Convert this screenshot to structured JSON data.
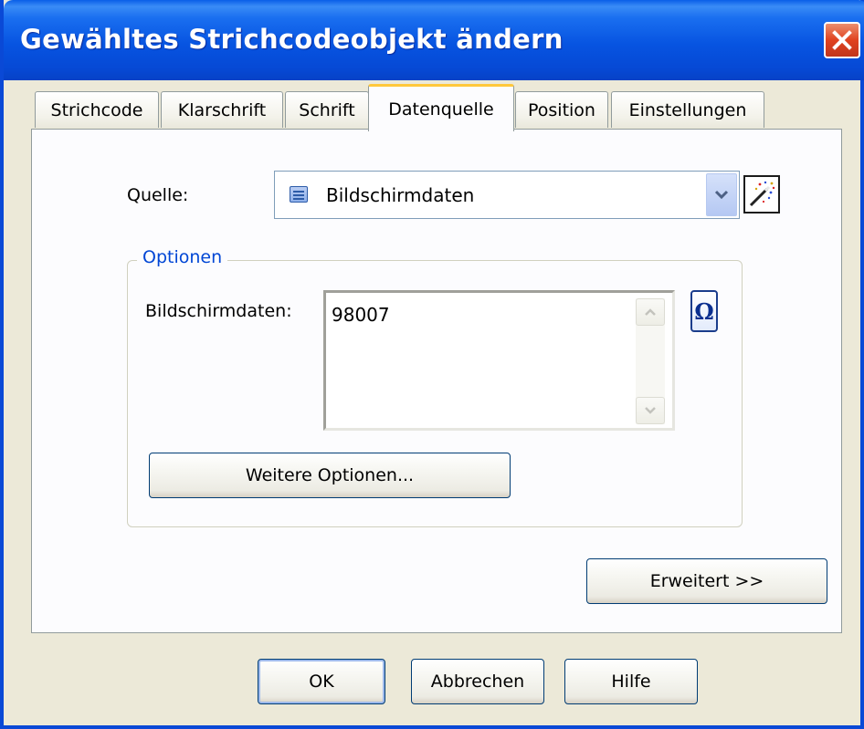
{
  "window": {
    "title": "Gewähltes Strichcodeobjekt ändern"
  },
  "tabs": [
    {
      "label": "Strichcode"
    },
    {
      "label": "Klarschrift"
    },
    {
      "label": "Schrift"
    },
    {
      "label": "Datenquelle",
      "active": true
    },
    {
      "label": "Position"
    },
    {
      "label": "Einstellungen"
    }
  ],
  "source": {
    "label": "Quelle:",
    "selected": "Bildschirmdaten",
    "selected_icon": "screen-data-icon",
    "wizard_icon": "magic-wand-icon"
  },
  "options": {
    "title": "Optionen",
    "screen_data_label": "Bildschirmdaten:",
    "screen_data_value": "98007",
    "special_chars_symbol": "Ω",
    "more_options_label": "Weitere Optionen..."
  },
  "advanced_label": "Erweitert >>",
  "footer": {
    "ok_label": "OK",
    "cancel_label": "Abbrechen",
    "help_label": "Hilfe"
  },
  "colors": {
    "title_bar": "#0754e1",
    "group_title": "#0046d5",
    "active_tab_accent": "#ffc83c",
    "close_button": "#e0421f"
  }
}
